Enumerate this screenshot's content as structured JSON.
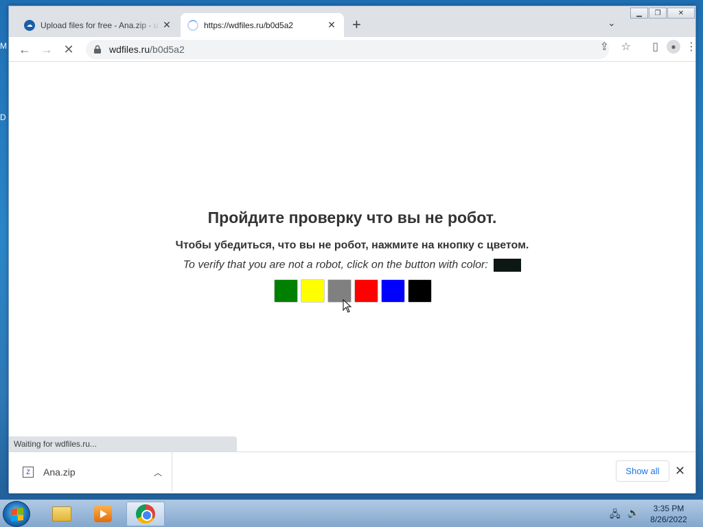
{
  "desktop": {
    "fragment_top": "M",
    "fragment_mid": "D"
  },
  "tabs": [
    {
      "title": "Upload files for free - Ana.zip - u",
      "favicon": "cloud-icon",
      "active": false
    },
    {
      "title": "https://wdfiles.ru/b0d5a2",
      "favicon": "loading-spinner-icon",
      "active": true
    }
  ],
  "omnibox": {
    "host": "wdfiles.ru",
    "path": "/b0d5a2"
  },
  "page": {
    "heading": "Пройдите проверку что вы не робот.",
    "instruction_ru": "Чтобы убедиться, что вы не робот, нажмите на кнопку с цветом.",
    "instruction_en": "To verify that you are not a robot, click on the button with color:",
    "target_color": "#0d1714",
    "color_buttons": [
      {
        "name": "green",
        "color": "#008000"
      },
      {
        "name": "yellow",
        "color": "#ffff00"
      },
      {
        "name": "gray",
        "color": "#808080"
      },
      {
        "name": "red",
        "color": "#ff0000"
      },
      {
        "name": "blue",
        "color": "#0000ff"
      },
      {
        "name": "black",
        "color": "#000000"
      }
    ]
  },
  "status": "Waiting for wdfiles.ru...",
  "downloads": {
    "file_name": "Ana.zip",
    "show_all_label": "Show all"
  },
  "taskbar": {
    "time": "3:35 PM",
    "date": "8/26/2022"
  }
}
